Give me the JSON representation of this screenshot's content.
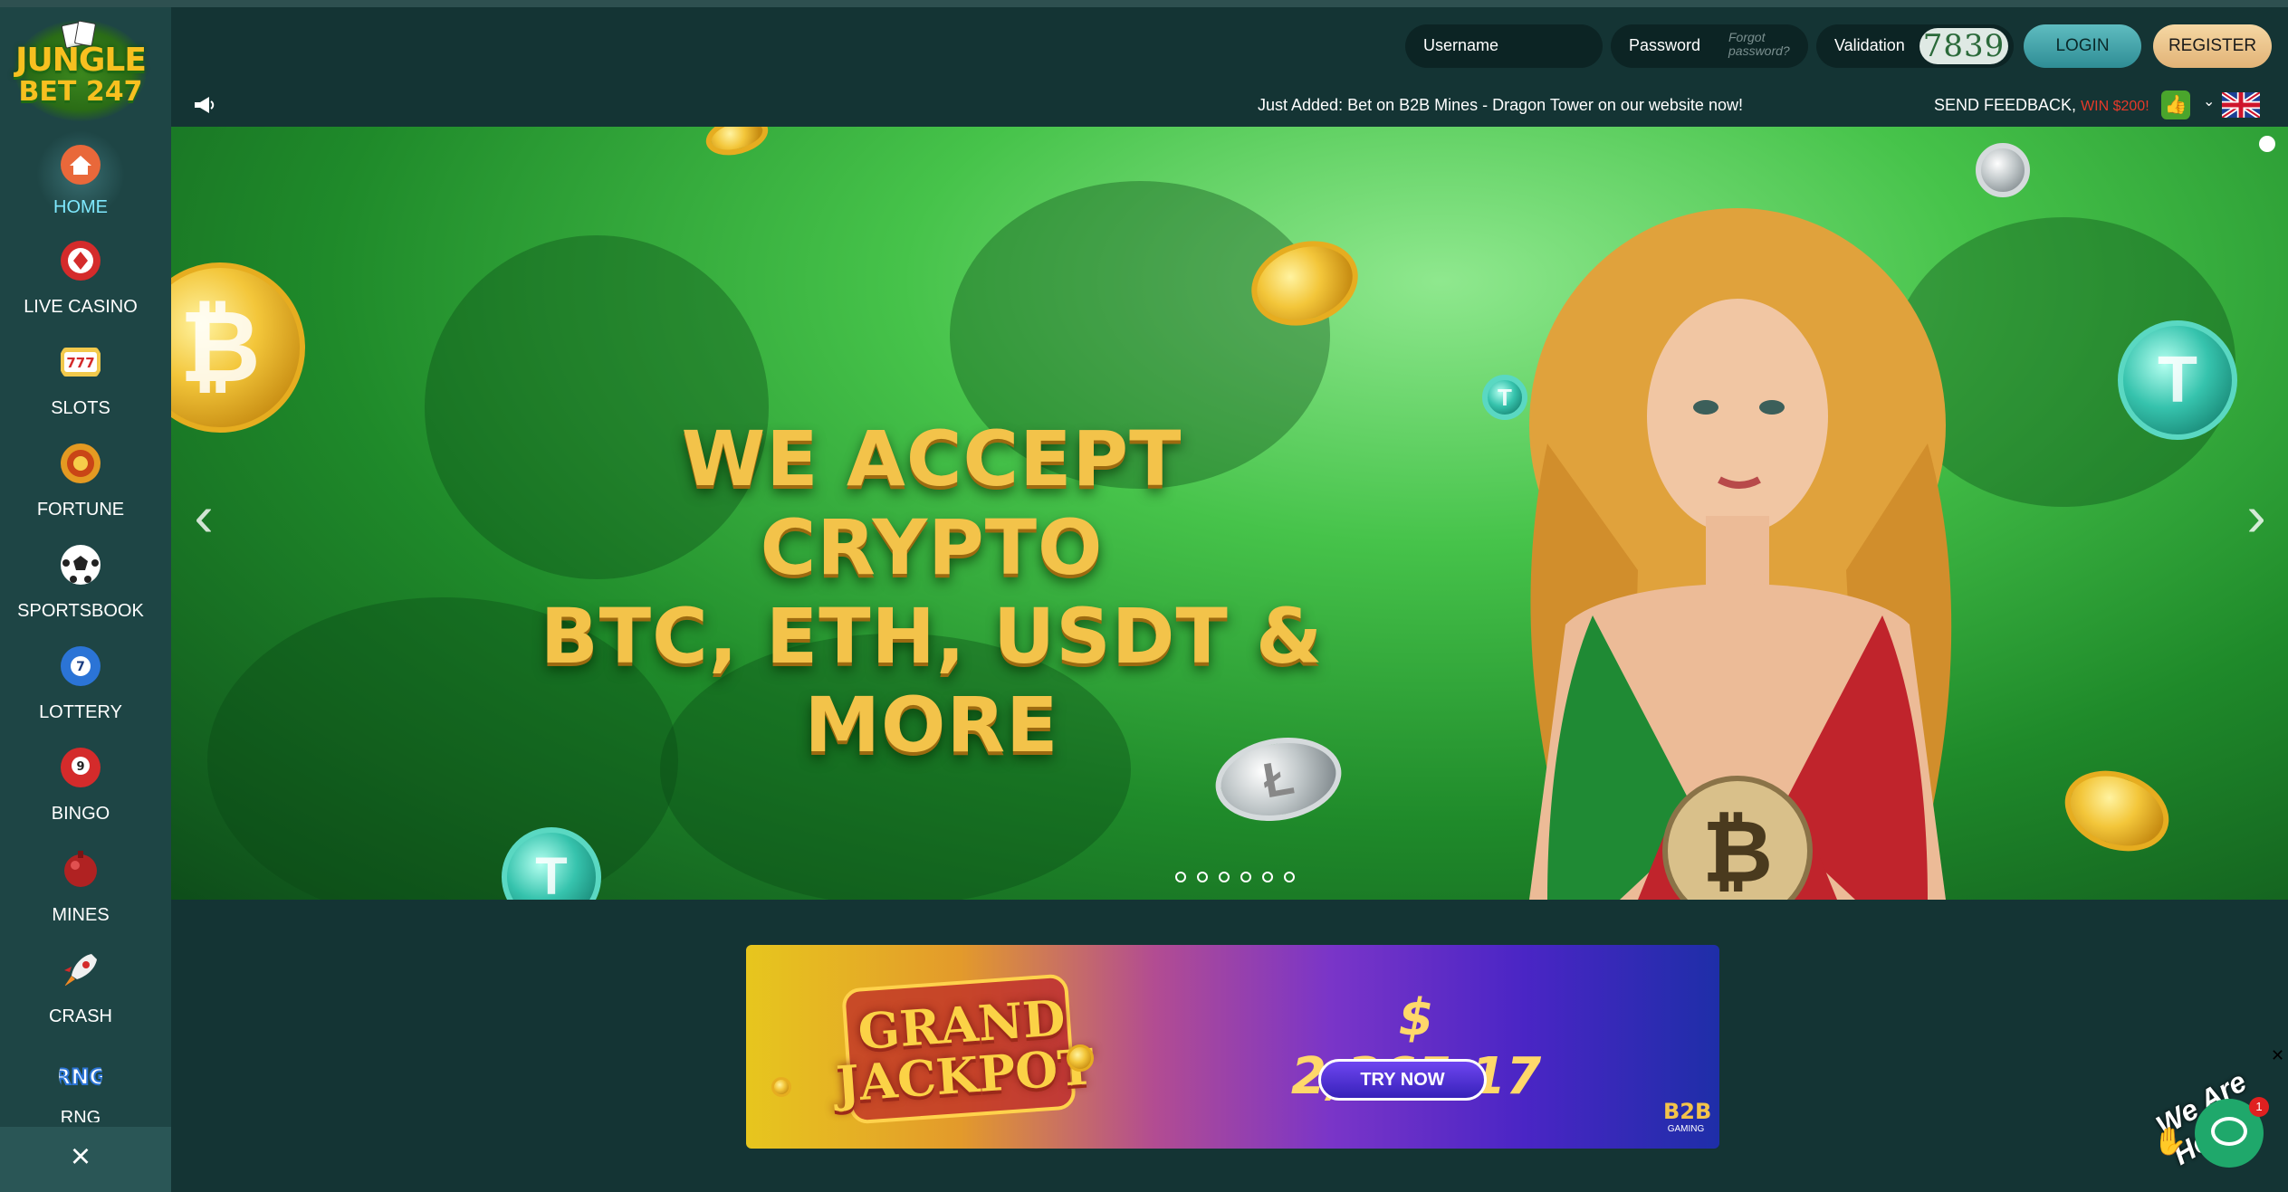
{
  "brand": {
    "line1": "JUNGLE",
    "line2": "BET 247"
  },
  "header": {
    "username_label": "Username",
    "password_label": "Password",
    "forgot_password": "Forgot password?",
    "validation_label": "Validation",
    "captcha_code": "7839",
    "login_label": "LOGIN",
    "register_label": "REGISTER"
  },
  "newsbar": {
    "ticker": "Just Added: Bet on B2B Mines - Dragon Tower on our website now!",
    "feedback_label": "SEND FEEDBACK,",
    "feedback_reward": "WIN $200!",
    "language_flag": "uk-flag-icon"
  },
  "sidebar": {
    "items": [
      {
        "label": "HOME",
        "icon": "home-icon",
        "active": true
      },
      {
        "label": "LIVE CASINO",
        "icon": "casino-chip-icon"
      },
      {
        "label": "SLOTS",
        "icon": "slot-777-icon"
      },
      {
        "label": "FORTUNE",
        "icon": "fortune-icon"
      },
      {
        "label": "SPORTSBOOK",
        "icon": "soccer-ball-icon"
      },
      {
        "label": "LOTTERY",
        "icon": "lottery-ball-icon"
      },
      {
        "label": "BINGO",
        "icon": "bingo-ball-icon"
      },
      {
        "label": "MINES",
        "icon": "mine-icon"
      },
      {
        "label": "CRASH",
        "icon": "rocket-icon"
      },
      {
        "label": "RNG",
        "icon": "rng-icon"
      }
    ]
  },
  "banner": {
    "headline_line1": "WE ACCEPT CRYPTO",
    "headline_line2": "BTC, ETH, USDT & MORE",
    "slide_count": 6,
    "active_slide": 1
  },
  "jackpot": {
    "title_line1": "GRAND",
    "title_line2": "JACKPOT",
    "amount": "$ 2,365.17",
    "cta": "TRY NOW",
    "provider_line1": "B2B",
    "provider_line2": "GAMING"
  },
  "chat": {
    "greeting": "We Are Here!",
    "unread": "1"
  },
  "colors": {
    "sidebar_bg": "#1e4545",
    "page_bg": "#143434",
    "active_nav": "#7fe9ff",
    "login_btn": "#2f8d95",
    "register_btn": "#e2b377",
    "headline_gold": "#f3c34a"
  }
}
